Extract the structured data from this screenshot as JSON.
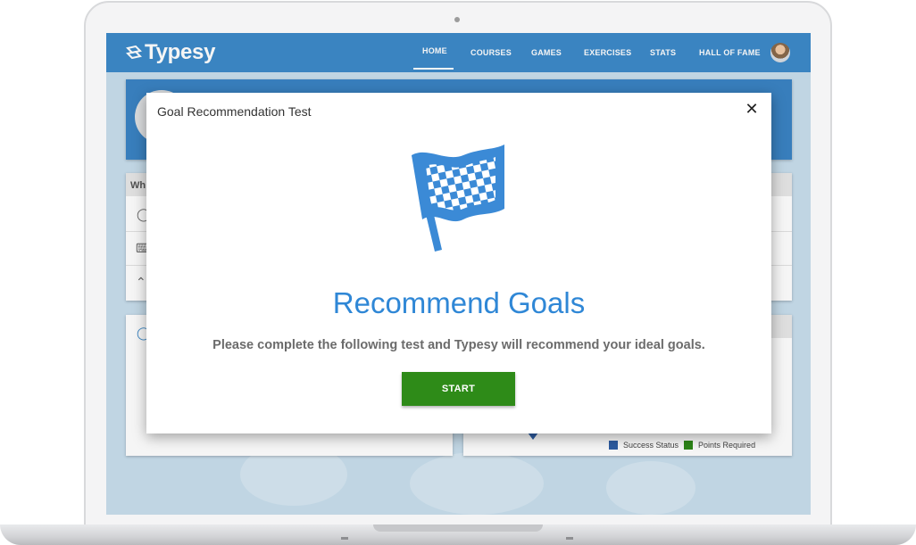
{
  "app": {
    "logo_text": "Typesy"
  },
  "nav": {
    "items": [
      {
        "label": "HOME",
        "active": true
      },
      {
        "label": "COURSES",
        "active": false
      },
      {
        "label": "GAMES",
        "active": false
      },
      {
        "label": "EXERCISES",
        "active": false
      },
      {
        "label": "STATS",
        "active": false
      },
      {
        "label": "HALL OF FAME",
        "active": false
      }
    ]
  },
  "background": {
    "card_title_partial": "Wh",
    "legend": [
      {
        "label": "Success Status",
        "color": "#2f5fa6"
      },
      {
        "label": "Points Required",
        "color": "#2e8b18"
      }
    ]
  },
  "modal": {
    "title": "Goal Recommendation Test",
    "close_icon": "close-icon",
    "flag_icon": "checkered-flag-icon",
    "heading": "Recommend Goals",
    "description": "Please complete the following test and Typesy will recommend your ideal goals.",
    "start_label": "START"
  },
  "colors": {
    "nav_blue": "#3d8ac9",
    "heading_blue": "#2f87d6",
    "start_green": "#2e8b18"
  }
}
